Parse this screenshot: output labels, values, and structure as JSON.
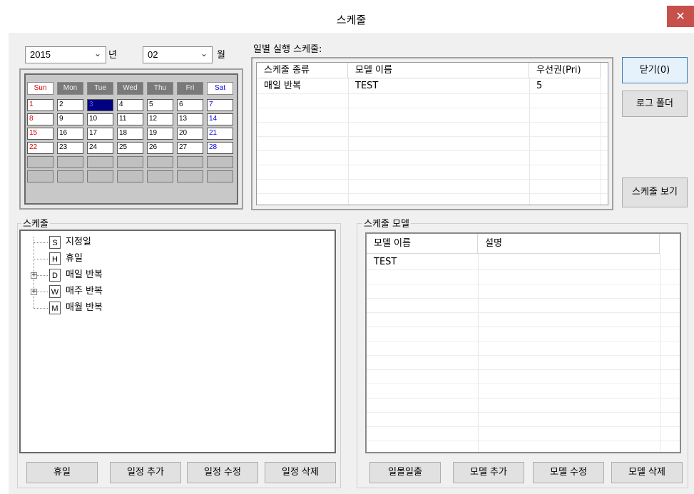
{
  "window": {
    "title": "스케줄",
    "close_label": "✕"
  },
  "top_controls": {
    "year_value": "2015",
    "year_label": "년",
    "month_value": "02",
    "month_label": "월"
  },
  "calendar": {
    "weekdays": [
      "Sun",
      "Mon",
      "Tue",
      "Wed",
      "Thu",
      "Fri",
      "Sat"
    ],
    "weeks": [
      [
        "1",
        "2",
        "3",
        "4",
        "5",
        "6",
        "7"
      ],
      [
        "8",
        "9",
        "10",
        "11",
        "12",
        "13",
        "14"
      ],
      [
        "15",
        "16",
        "17",
        "18",
        "19",
        "20",
        "21"
      ],
      [
        "22",
        "23",
        "24",
        "25",
        "26",
        "27",
        "28"
      ],
      [
        "",
        "",
        "",
        "",
        "",
        "",
        ""
      ],
      [
        "",
        "",
        "",
        "",
        "",
        "",
        ""
      ]
    ],
    "selected_day": "3",
    "colors": {
      "sunday": "#e00000",
      "saturday": "#0000e0",
      "selected_bg": "#000080"
    }
  },
  "daily_schedule": {
    "title": "일별 실행 스케줄:",
    "columns": [
      "스케줄 종류",
      "모델 이름",
      "우선권(Pri)"
    ],
    "rows": [
      [
        "매일 반복",
        "TEST",
        "5"
      ]
    ]
  },
  "side_buttons": {
    "close": "닫기(0)",
    "log_folder": "로그 폴더",
    "view_schedule": "스케줄 보기"
  },
  "schedule_tree": {
    "title": "스케줄",
    "items": [
      {
        "label": "지정일",
        "icon_letter": "S",
        "expandable": false
      },
      {
        "label": "휴일",
        "icon_letter": "H",
        "expandable": false
      },
      {
        "label": "매일 반복",
        "icon_letter": "D",
        "expandable": true
      },
      {
        "label": "매주 반복",
        "icon_letter": "W",
        "expandable": true
      },
      {
        "label": "매월 반복",
        "icon_letter": "M",
        "expandable": false
      }
    ]
  },
  "schedule_buttons": {
    "holiday": "휴일",
    "add": "일정 추가",
    "edit": "일정 수정",
    "delete": "일정 삭제"
  },
  "schedule_model": {
    "title": "스케줄 모델",
    "columns": [
      "모델 이름",
      "설명"
    ],
    "rows": [
      [
        "TEST",
        ""
      ]
    ]
  },
  "model_buttons": {
    "sunrise": "일몰일출",
    "add": "모델 추가",
    "edit": "모델 수정",
    "delete": "모델 삭제"
  }
}
